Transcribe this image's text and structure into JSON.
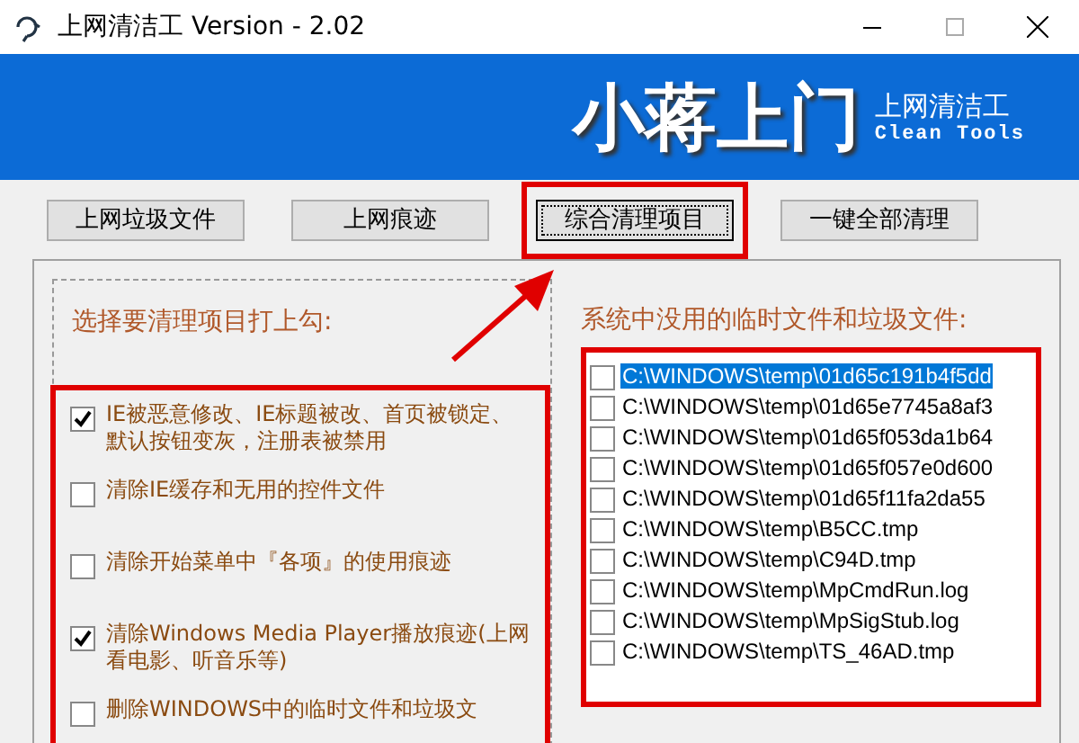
{
  "window": {
    "title": "上网清洁工 Version - 2.02"
  },
  "banner": {
    "title": "小蒋上门",
    "subtitle": "上网清洁工",
    "subtitle_en": "Clean Tools"
  },
  "toolbar": [
    {
      "label": "上网垃圾文件",
      "selected": false,
      "highlighted": false
    },
    {
      "label": "上网痕迹",
      "selected": false,
      "highlighted": false
    },
    {
      "label": "综合清理项目",
      "selected": true,
      "highlighted": true
    },
    {
      "label": "一键全部清理",
      "selected": false,
      "highlighted": false
    }
  ],
  "options": {
    "title": "选择要清理项目打上勾:",
    "items": [
      {
        "label": "IE被恶意修改、IE标题被改、首页被锁定、默认按钮变灰，注册表被禁用",
        "checked": true
      },
      {
        "label": "清除IE缓存和无用的控件文件",
        "checked": false
      },
      {
        "label": "清除开始菜单中『各项』的使用痕迹",
        "checked": false
      },
      {
        "label": "清除Windows Media Player播放痕迹(上网看电影、听音乐等)",
        "checked": true
      },
      {
        "label": "删除WINDOWS中的临时文件和垃圾文",
        "checked": false
      }
    ]
  },
  "files": {
    "title": "系统中没用的临时文件和垃圾文件:",
    "items": [
      {
        "path": "C:\\WINDOWS\\temp\\01d65c191b4f5dd",
        "checked": false,
        "selected": true
      },
      {
        "path": "C:\\WINDOWS\\temp\\01d65e7745a8af3",
        "checked": false,
        "selected": false
      },
      {
        "path": "C:\\WINDOWS\\temp\\01d65f053da1b64",
        "checked": false,
        "selected": false
      },
      {
        "path": "C:\\WINDOWS\\temp\\01d65f057e0d600",
        "checked": false,
        "selected": false
      },
      {
        "path": "C:\\WINDOWS\\temp\\01d65f11fa2da55",
        "checked": false,
        "selected": false
      },
      {
        "path": "C:\\WINDOWS\\temp\\B5CC.tmp",
        "checked": false,
        "selected": false
      },
      {
        "path": "C:\\WINDOWS\\temp\\C94D.tmp",
        "checked": false,
        "selected": false
      },
      {
        "path": "C:\\WINDOWS\\temp\\MpCmdRun.log",
        "checked": false,
        "selected": false
      },
      {
        "path": "C:\\WINDOWS\\temp\\MpSigStub.log",
        "checked": false,
        "selected": false
      },
      {
        "path": "C:\\WINDOWS\\temp\\TS_46AD.tmp",
        "checked": false,
        "selected": false
      }
    ]
  }
}
